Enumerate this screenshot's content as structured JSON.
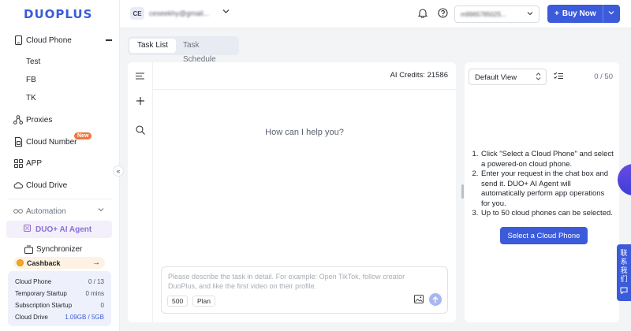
{
  "app": {
    "logo": "DUOPLUS"
  },
  "sidebar": {
    "cloud_phone": {
      "label": "Cloud Phone",
      "groups": [
        "Test",
        "FB",
        "TK"
      ]
    },
    "proxies": "Proxies",
    "cloud_number": "Cloud Number",
    "new_badge": "New",
    "app": "APP",
    "cloud_drive": "Cloud Drive",
    "automation": "Automation",
    "ai_agent": "DUO+ AI Agent",
    "synchronizer": "Synchronizer",
    "cashback": "Cashback",
    "collapse_glyph": "«"
  },
  "stats": {
    "rows": [
      {
        "label": "Cloud Phone",
        "value": "0 / 13"
      },
      {
        "label": "Temporary Startup",
        "value": "0 mins"
      },
      {
        "label": "Subscription Startup",
        "value": "0"
      },
      {
        "label": "Cloud Drive",
        "value": "1.09GB / 5GB"
      }
    ]
  },
  "header": {
    "account_initials": "CE",
    "account_email": "ceseekhy@gmail...",
    "phone_select_value": "m9965785025...",
    "buy_now": "Buy Now",
    "buy_plus": "+"
  },
  "tabs": {
    "task_list": "Task List",
    "task_schedule": "Task Schedule"
  },
  "chat": {
    "ai_credits": "AI Credits: 21586",
    "prompt": "How can I help you?",
    "placeholder": "Please describe the task in detail. For example: Open TikTok, follow creator DuoPlus, and like the first video on their profile.",
    "char_count": "500",
    "plan_chip": "Plan"
  },
  "right_panel": {
    "view_select": "Default View",
    "count": "0 / 50",
    "instructions": [
      "Click \"Select a Cloud Phone\" and select a powered-on cloud phone.",
      "Enter your request in the chat box and send it. DUO+ AI Agent will automatically perform app operations for you.",
      "Up to 50 cloud phones can be selected."
    ],
    "select_button": "Select a Cloud Phone"
  },
  "floating": {
    "contact_label": "联系我们"
  },
  "colors": {
    "primary": "#3b5bdb",
    "badge": "#f0763e",
    "agent": "#8a6fd8"
  }
}
